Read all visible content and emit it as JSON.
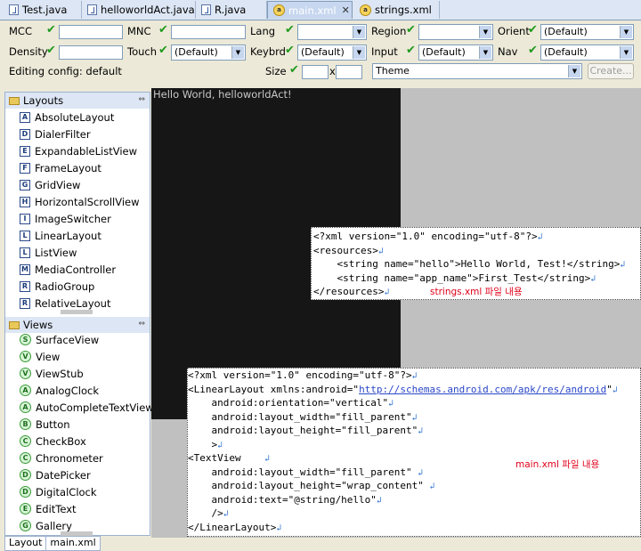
{
  "tabs": [
    {
      "label": "Test.java",
      "icon": "java-file-icon",
      "active": false
    },
    {
      "label": "helloworldAct.java",
      "icon": "java-file-icon",
      "active": false
    },
    {
      "label": "R.java",
      "icon": "java-file-icon",
      "active": false
    },
    {
      "label": "main.xml",
      "icon": "xml-file-icon",
      "active": true,
      "close": "✕"
    },
    {
      "label": "strings.xml",
      "icon": "xml-file-icon",
      "active": false
    }
  ],
  "config": {
    "mcc_label": "MCC",
    "mnc_label": "MNC",
    "lang_label": "Lang",
    "region_label": "Region",
    "orient_label": "Orient",
    "orient_value": "(Default)",
    "density_label": "Density",
    "touch_label": "Touch",
    "touch_value": "(Default)",
    "keybrd_label": "Keybrd",
    "keybrd_value": "(Default)",
    "input_label": "Input",
    "input_value": "(Default)",
    "nav_label": "Nav",
    "nav_value": "(Default)",
    "editing_config": "Editing config: default",
    "size_label": "Size",
    "size_x": "x",
    "theme_value": "Theme",
    "create_button": "Create...",
    "check_glyph": "✔"
  },
  "palette": {
    "layouts_header": "Layouts",
    "views_header": "Views",
    "collapse_glyph": "⇔",
    "layouts": [
      {
        "label": "AbsoluteLayout",
        "letter": "A"
      },
      {
        "label": "DialerFilter",
        "letter": "D"
      },
      {
        "label": "ExpandableListView",
        "letter": "E"
      },
      {
        "label": "FrameLayout",
        "letter": "F"
      },
      {
        "label": "GridView",
        "letter": "G"
      },
      {
        "label": "HorizontalScrollView",
        "letter": "H"
      },
      {
        "label": "ImageSwitcher",
        "letter": "I"
      },
      {
        "label": "LinearLayout",
        "letter": "L"
      },
      {
        "label": "ListView",
        "letter": "L"
      },
      {
        "label": "MediaController",
        "letter": "M"
      },
      {
        "label": "RadioGroup",
        "letter": "R"
      },
      {
        "label": "RelativeLayout",
        "letter": "R"
      }
    ],
    "views": [
      {
        "label": "SurfaceView",
        "letter": "S"
      },
      {
        "label": "View",
        "letter": "V"
      },
      {
        "label": "ViewStub",
        "letter": "V"
      },
      {
        "label": "AnalogClock",
        "letter": "A"
      },
      {
        "label": "AutoCompleteTextView",
        "letter": "A"
      },
      {
        "label": "Button",
        "letter": "B"
      },
      {
        "label": "CheckBox",
        "letter": "C"
      },
      {
        "label": "Chronometer",
        "letter": "C"
      },
      {
        "label": "DatePicker",
        "letter": "D"
      },
      {
        "label": "DigitalClock",
        "letter": "D"
      },
      {
        "label": "EditText",
        "letter": "E"
      },
      {
        "label": "Gallery",
        "letter": "G"
      }
    ]
  },
  "bottom_tabs": [
    "Layout",
    "main.xml"
  ],
  "preview": {
    "hello_text": "Hello World, helloworldAct!"
  },
  "strings_xml": {
    "lines": [
      "<?xml version=\"1.0\" encoding=\"utf-8\"?>",
      "<resources>",
      "    <string name=\"hello\">Hello World, Test!</string>",
      "    <string name=\"app_name\">First_Test</string>",
      "</resources>"
    ],
    "cr_glyph": "↲",
    "note": "strings.xml 파일 내용"
  },
  "main_xml": {
    "lines": [
      {
        "text": "<?xml version=\"1.0\" encoding=\"utf-8\"?>"
      },
      {
        "text": "<LinearLayout xmlns:android=\"",
        "link": "http://schemas.android.com/apk/res/android",
        "after": "\""
      },
      {
        "text": "    android:orientation=\"vertical\""
      },
      {
        "text": "    android:layout_width=\"fill_parent\""
      },
      {
        "text": "    android:layout_height=\"fill_parent\""
      },
      {
        "text": "    >"
      },
      {
        "text": "<TextView    "
      },
      {
        "text": "    android:layout_width=\"fill_parent\" "
      },
      {
        "text": "    android:layout_height=\"wrap_content\" "
      },
      {
        "text": "    android:text=\"@string/hello\""
      },
      {
        "text": "    />"
      },
      {
        "text": "</LinearLayout>"
      }
    ],
    "note": "main.xml 파일 내용"
  }
}
